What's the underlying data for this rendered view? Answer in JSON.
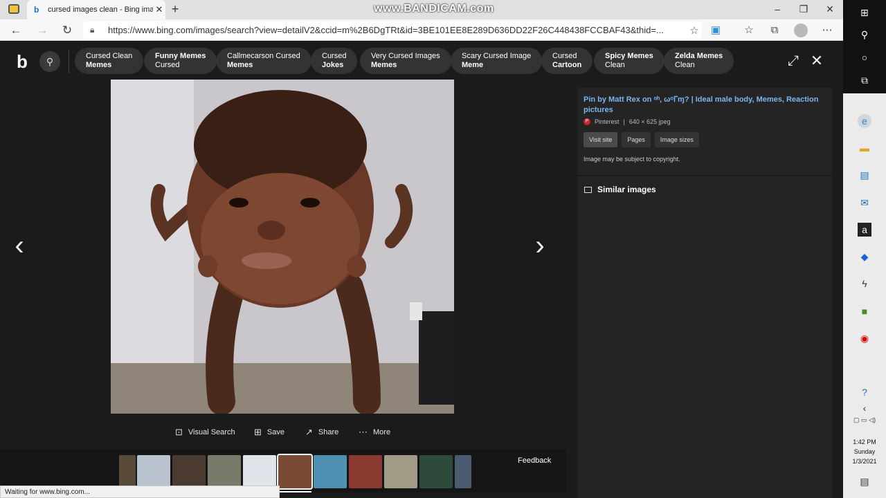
{
  "browser": {
    "tab_title": "cursed images clean - Bing imag",
    "tab_close": "✕",
    "new_tab": "+",
    "watermark": "www.BANDICAM.com",
    "url": "https://www.bing.com/images/search?view=detailV2&ccid=m%2B6DgTRt&id=3BE101EE8E289D636DD22F26C448438FCCBAF43&thid=...",
    "status_text": "Waiting for www.bing.com..."
  },
  "bing": {
    "chips": [
      {
        "line1": "Cursed Clean",
        "line2": "Memes"
      },
      {
        "line1": "Funny Memes",
        "line2": "Cursed"
      },
      {
        "line1": "Callmecarson Cursed",
        "line2": "Memes"
      },
      {
        "line1": "Cursed",
        "line2": "Jokes"
      },
      {
        "line1": "Very Cursed Images",
        "line2": "Memes"
      },
      {
        "line1": "Scary Cursed Image",
        "line2": "Meme"
      },
      {
        "line1": "Cursed",
        "line2": "Cartoon"
      },
      {
        "line1": "Spicy Memes",
        "line2": "Clean"
      },
      {
        "line1": "Zelda Memes",
        "line2": "Clean"
      }
    ]
  },
  "viewer": {
    "actions": {
      "visual_search": "Visual Search",
      "save": "Save",
      "share": "Share",
      "more": "More"
    },
    "feedback": "Feedback"
  },
  "info": {
    "title": "Pin by Matt Rex on ᵒʰ, ωᵒᒥɱ? | Ideal male body, Memes, Reaction pictures",
    "source": "Pinterest",
    "dims": "640 × 625 jpeg",
    "btn_visit": "Visit site",
    "btn_pages": "Pages",
    "btn_sizes": "Image sizes",
    "copyright": "Image may be subject to copyright.",
    "similar": "Similar images"
  },
  "taskbar": {
    "time": "1:42 PM",
    "day": "Sunday",
    "date": "1/3/2021"
  },
  "colors": {
    "link": "#7cb6f0",
    "background": "#1b1b1b",
    "panel": "#242424",
    "chip": "#333333"
  }
}
